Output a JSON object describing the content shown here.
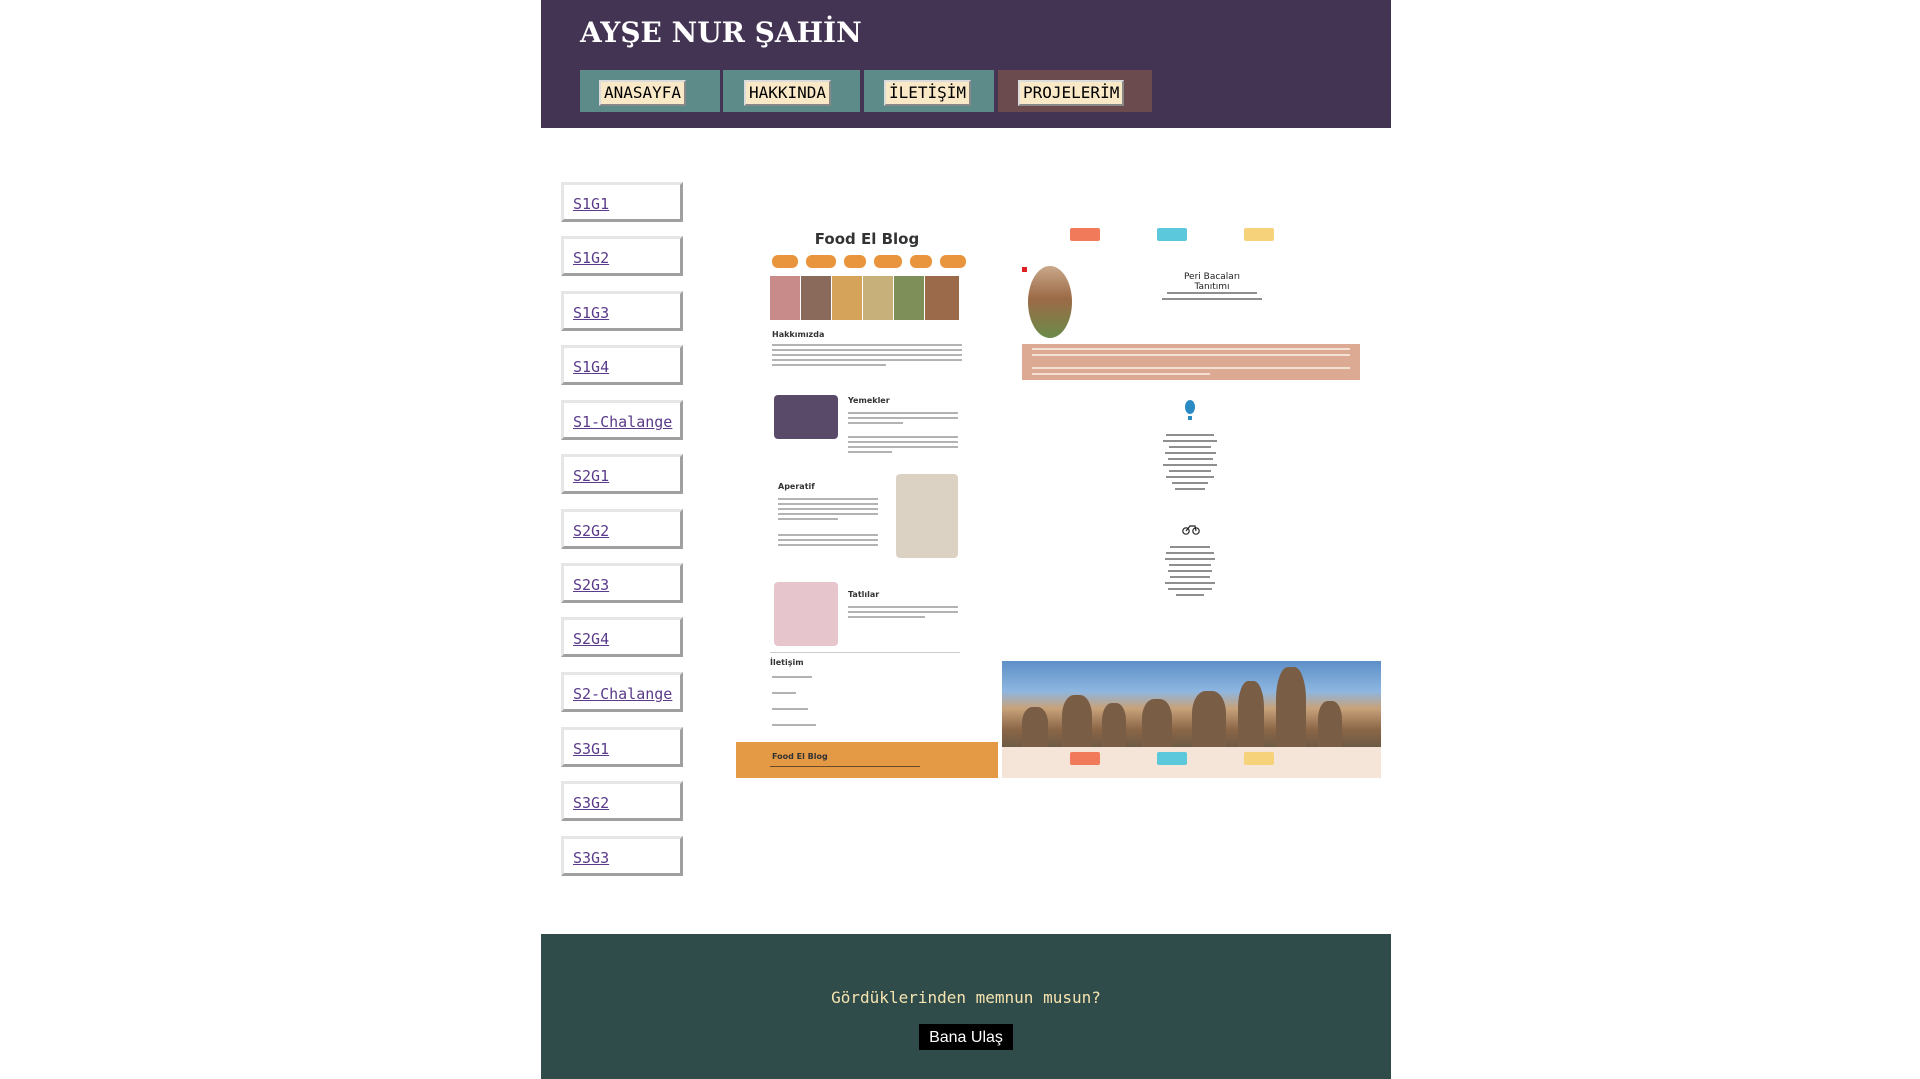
{
  "header": {
    "title": "AYŞE NUR ŞAHİN",
    "nav": [
      "ANASAYFA",
      "HAKKINDA",
      "İLETİŞİM",
      "PROJELERİM"
    ]
  },
  "sidebar": {
    "items": [
      "S1G1",
      "S1G2",
      "S1G3",
      "S1G4",
      "S1-Chalange",
      "S2G1",
      "S2G2",
      "S2G3",
      "S2G4",
      "S2-Chalange",
      "S3G1",
      "S3G2",
      "S3G3"
    ]
  },
  "preview_food": {
    "title": "Food El Blog",
    "about": "Hakkımızda",
    "section1": "Yemekler",
    "section2": "Aperatif",
    "section3": "Tatlılar",
    "contact": "İletişim",
    "footer_title": "Food El Blog"
  },
  "preview_peri": {
    "title": "Peri Bacaları Tanıtımı"
  },
  "footer": {
    "question": "Gördüklerinden memnun musun?",
    "button": "Bana Ulaş"
  },
  "colors": {
    "header_bg": "#433454",
    "nav_bg": "#5c8b8a",
    "nav_active_bg": "#6b4b4e",
    "footer_bg": "#2f4b4a",
    "food_accent": "#e49a44"
  }
}
